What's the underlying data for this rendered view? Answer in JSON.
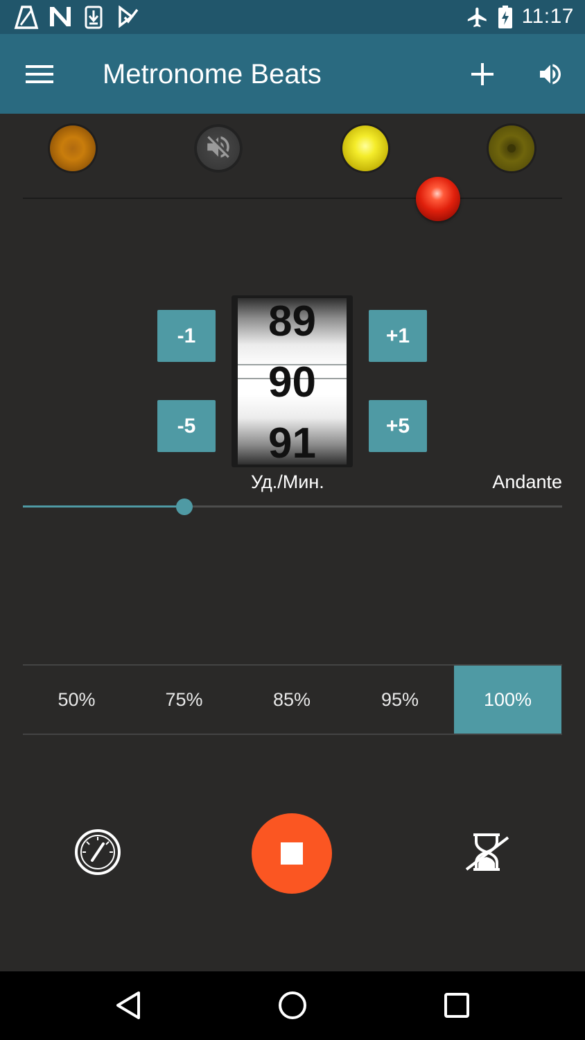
{
  "status_bar": {
    "time": "11:17",
    "icons": [
      "metronome-app-icon",
      "n-icon",
      "download-icon",
      "check-icon",
      "airplane-mode-icon",
      "battery-charging-icon"
    ]
  },
  "app_bar": {
    "title": "Metronome Beats",
    "menu_icon": "hamburger-menu-icon",
    "add_icon": "plus-icon",
    "sound_icon": "volume-icon"
  },
  "beat_lights": [
    {
      "name": "beat-light-1",
      "color": "#c97d0c"
    },
    {
      "name": "beat-light-2-muted",
      "icon": "mute-icon"
    },
    {
      "name": "beat-light-3",
      "color": "#f4ec2a"
    },
    {
      "name": "beat-light-4",
      "color": "#6f650c"
    }
  ],
  "tempo": {
    "minus_1": "-1",
    "minus_5": "-5",
    "plus_1": "+1",
    "plus_5": "+5",
    "picker_values": [
      "89",
      "90",
      "91"
    ],
    "selected_bpm": "90",
    "bpm_unit": "Уд./Мин.",
    "tempo_name": "Andante"
  },
  "slider": {
    "value_fraction": 0.3
  },
  "percent_options": [
    {
      "label": "50%",
      "active": false
    },
    {
      "label": "75%",
      "active": false
    },
    {
      "label": "85%",
      "active": false
    },
    {
      "label": "95%",
      "active": false
    },
    {
      "label": "100%",
      "active": true
    }
  ],
  "controls": {
    "left_icon": "gauge-icon",
    "center_icon": "stop-icon",
    "right_icon": "timer-off-icon"
  },
  "nav": {
    "back_icon": "back-icon",
    "home_icon": "home-icon",
    "recents_icon": "recents-icon"
  },
  "colors": {
    "accent": "#4f9aa4",
    "app_bar": "#2a6a80",
    "status_bar": "#21566b",
    "play_button": "#fb5622",
    "background": "#2a2928"
  }
}
